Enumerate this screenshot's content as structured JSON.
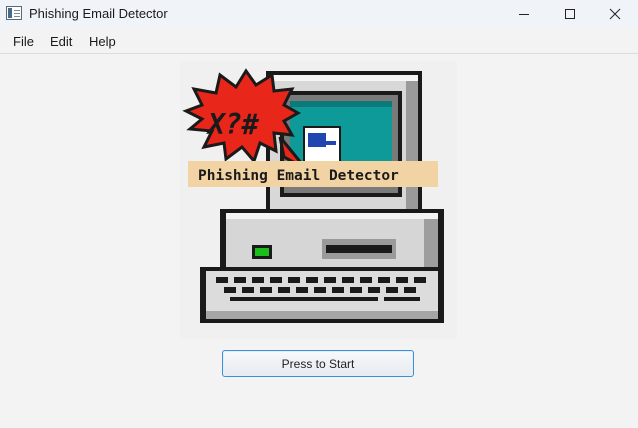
{
  "window": {
    "title": "Phishing Email Detector",
    "controls": [
      "minimize-icon",
      "maximize-icon",
      "close-icon"
    ]
  },
  "menu": {
    "items": [
      {
        "label": "File"
      },
      {
        "label": "Edit"
      },
      {
        "label": "Help"
      }
    ]
  },
  "illustration": {
    "burst_text": "X?#",
    "banner_text": "Phishing Email Detector",
    "colors": {
      "burst": "#e8261a",
      "banner": "#f2d3a4",
      "screen": "#0f9a9a",
      "body": "#c9c9c9",
      "led": "#1bbf1b"
    }
  },
  "start_button": {
    "label": "Press to Start",
    "accent": "#3c8fd6"
  }
}
